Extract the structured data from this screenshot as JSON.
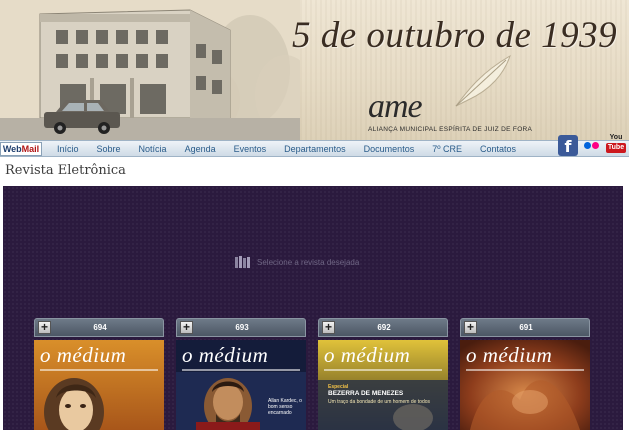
{
  "header": {
    "headline": "5 de outubro de 1939",
    "logo_mark": "ame",
    "logo_tagline": "ALIANÇA MUNICIPAL ESPÍRITA DE JUIZ DE FORA"
  },
  "nav": {
    "webmail_web": "Web",
    "webmail_mail": "Mail",
    "items": [
      {
        "label": "Início"
      },
      {
        "label": "Sobre"
      },
      {
        "label": "Notícia"
      },
      {
        "label": "Agenda"
      },
      {
        "label": "Eventos"
      },
      {
        "label": "Departamentos"
      },
      {
        "label": "Documentos"
      },
      {
        "label": "7º CRE"
      },
      {
        "label": "Contatos"
      }
    ],
    "social": {
      "facebook_glyph": "f",
      "youtube_you": "You",
      "youtube_tube": "Tube"
    }
  },
  "page": {
    "title": "Revista Eletrônica"
  },
  "viewer": {
    "hint": "Selecione a revista desejada",
    "plus_glyph": "+",
    "magazines": [
      {
        "number": "694",
        "cover_title": "o médium"
      },
      {
        "number": "693",
        "cover_title": "o médium",
        "cover_side": "Allan Kardec, o bom senso encarnado"
      },
      {
        "number": "692",
        "cover_title": "o médium",
        "cover_tag": "Especial",
        "cover_headline": "BEZERRA DE MENEZES",
        "cover_caption": "Um traço da bondade de um homem de todos"
      },
      {
        "number": "691",
        "cover_title": "o médium"
      }
    ]
  },
  "colors": {
    "viewer_bg": "#2b1a3e",
    "nav_text": "#2a5c8a",
    "webmail_accent": "#b01313"
  }
}
